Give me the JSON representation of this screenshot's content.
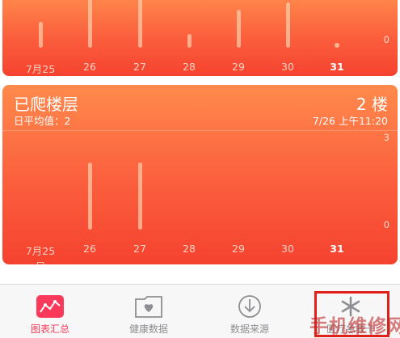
{
  "x_labels": [
    "7月25日",
    "26",
    "27",
    "28",
    "29",
    "30",
    "31"
  ],
  "card_top": {
    "y_tick_zero": "0",
    "bars": [
      0.42,
      0.95,
      0.95,
      0.22,
      0.62,
      0.75,
      0.0
    ]
  },
  "card_floors": {
    "title": "已爬楼层",
    "value": "2 楼",
    "average": "日平均值：2",
    "timestamp": "7/26 上午11:20",
    "y_tick_max": "3",
    "y_tick_zero": "0",
    "bars": [
      0.0,
      0.92,
      0.92,
      0.0,
      0.0,
      0.0,
      0.0
    ]
  },
  "chart_data": [
    {
      "type": "bar",
      "categories": [
        "7月25日",
        "26",
        "27",
        "28",
        "29",
        "30",
        "31"
      ],
      "values": [
        0,
        2,
        2,
        0,
        0,
        0,
        0
      ],
      "title": "已爬楼层",
      "ylim": [
        0,
        3
      ]
    }
  ],
  "tabbar": {
    "tabs": [
      {
        "label": "图表汇总",
        "icon": "chart-summary-icon",
        "active": true
      },
      {
        "label": "健康数据",
        "icon": "health-data-folder-icon",
        "active": false
      },
      {
        "label": "数据来源",
        "icon": "data-sources-download-icon",
        "active": false
      },
      {
        "label": "医疗急救卡",
        "icon": "medical-id-icon",
        "active": false
      }
    ]
  },
  "colors": {
    "card_gradient_top": "#ff8a4c",
    "card_gradient_bottom": "#f5422f",
    "active_tab": "#fb3a5b",
    "highlight_box": "#e0201a"
  },
  "watermark": "手机维修网"
}
